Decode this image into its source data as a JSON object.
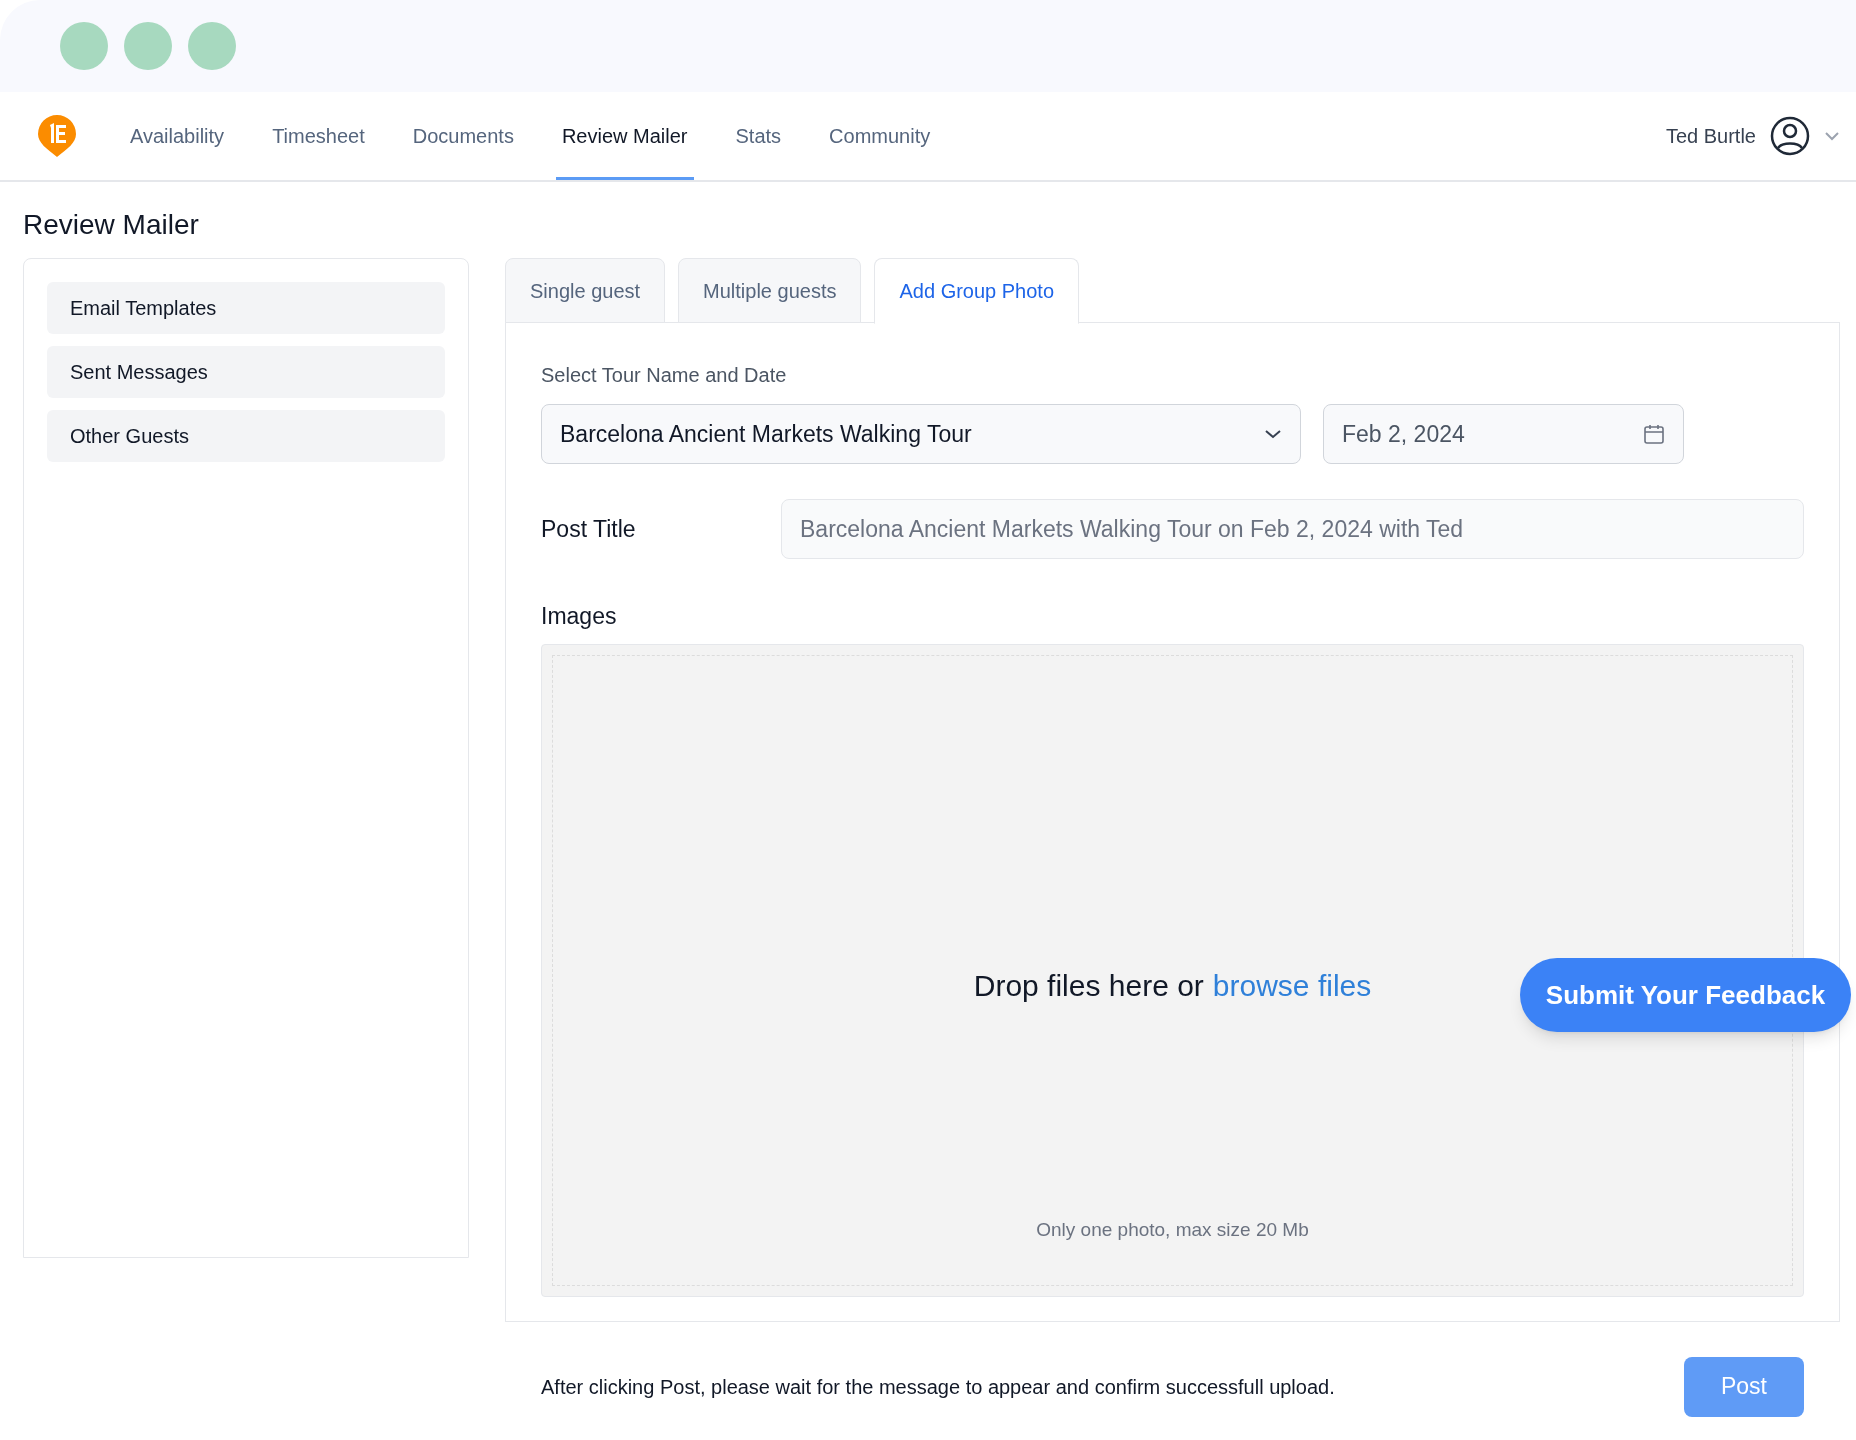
{
  "nav": {
    "items": [
      {
        "label": "Availability",
        "selected": false
      },
      {
        "label": "Timesheet",
        "selected": false
      },
      {
        "label": "Documents",
        "selected": false
      },
      {
        "label": "Review Mailer",
        "selected": true
      },
      {
        "label": "Stats",
        "selected": false
      },
      {
        "label": "Community",
        "selected": false
      }
    ],
    "user": {
      "name": "Ted Burtle"
    }
  },
  "page_title": "Review Mailer",
  "sidebar": {
    "items": [
      "Email Templates",
      "Sent Messages",
      "Other Guests"
    ]
  },
  "tabs": [
    {
      "label": "Single guest",
      "selected": false
    },
    {
      "label": "Multiple guests",
      "selected": false
    },
    {
      "label": "Add Group Photo",
      "selected": true
    }
  ],
  "form": {
    "tour_label": "Select Tour Name and Date",
    "tour_value": "Barcelona Ancient Markets Walking Tour",
    "date_value": "Feb 2, 2024",
    "post_title_label": "Post Title",
    "post_title_placeholder": "Barcelona Ancient Markets Walking Tour on Feb 2, 2024 with Ted",
    "images_label": "Images",
    "drop_text": "Drop files here or",
    "browse_link": "browse files",
    "drop_hint": "Only one photo, max size 20 Mb",
    "footer_note": "After clicking Post, please wait for the message to appear and confirm successfull upload.",
    "post_button": "Post"
  },
  "feedback_button": "Submit Your Feedback"
}
